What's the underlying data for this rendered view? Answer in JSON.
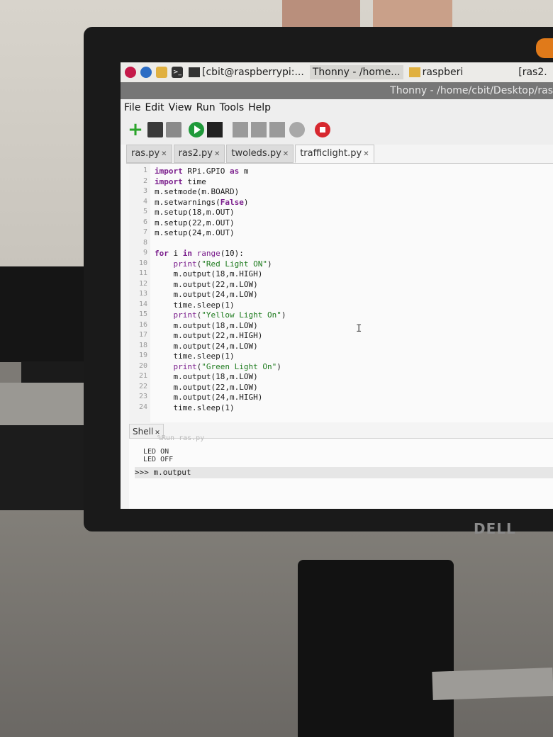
{
  "taskbar": {
    "tasks": [
      {
        "label": "[cbit@raspberrypi:..."
      },
      {
        "label": "Thonny  -  /home..."
      },
      {
        "label": "raspberi"
      },
      {
        "label": "[ras2."
      }
    ]
  },
  "window": {
    "title": "Thonny  -  /home/cbit/Desktop/ras"
  },
  "menu": {
    "items": [
      "File",
      "Edit",
      "View",
      "Run",
      "Tools",
      "Help"
    ]
  },
  "tabs": [
    {
      "label": "ras.py"
    },
    {
      "label": "ras2.py"
    },
    {
      "label": "twoleds.py"
    },
    {
      "label": "trafficlight.py",
      "active": true
    }
  ],
  "editor": {
    "lines": [
      {
        "n": "1",
        "code": "import RPi.GPIO as m"
      },
      {
        "n": "2",
        "code": "import time"
      },
      {
        "n": "3",
        "code": "m.setmode(m.BOARD)"
      },
      {
        "n": "4",
        "code": "m.setwarnings(False)"
      },
      {
        "n": "5",
        "code": "m.setup(18,m.OUT)"
      },
      {
        "n": "6",
        "code": "m.setup(22,m.OUT)"
      },
      {
        "n": "7",
        "code": "m.setup(24,m.OUT)"
      },
      {
        "n": "8",
        "code": ""
      },
      {
        "n": "9",
        "code": "for i in range(10):"
      },
      {
        "n": "10",
        "code": "    print(\"Red Light ON\")"
      },
      {
        "n": "11",
        "code": "    m.output(18,m.HIGH)"
      },
      {
        "n": "12",
        "code": "    m.output(22,m.LOW)"
      },
      {
        "n": "13",
        "code": "    m.output(24,m.LOW)"
      },
      {
        "n": "14",
        "code": "    time.sleep(1)"
      },
      {
        "n": "15",
        "code": "    print(\"Yellow Light On\")"
      },
      {
        "n": "16",
        "code": "    m.output(18,m.LOW)"
      },
      {
        "n": "17",
        "code": "    m.output(22,m.HIGH)"
      },
      {
        "n": "18",
        "code": "    m.output(24,m.LOW)"
      },
      {
        "n": "19",
        "code": "    time.sleep(1)"
      },
      {
        "n": "20",
        "code": "    print(\"Green Light On\")"
      },
      {
        "n": "21",
        "code": "    m.output(18,m.LOW)"
      },
      {
        "n": "22",
        "code": "    m.output(22,m.LOW)"
      },
      {
        "n": "23",
        "code": "    m.output(24,m.HIGH)"
      },
      {
        "n": "24",
        "code": "    time.sleep(1)"
      }
    ]
  },
  "shell": {
    "tab_label": "Shell",
    "faded": "%Run ras.py",
    "output": [
      "LED ON",
      "LED OFF"
    ],
    "prompt": ">>> m.output"
  },
  "brand": {
    "monitor": "DELL"
  }
}
